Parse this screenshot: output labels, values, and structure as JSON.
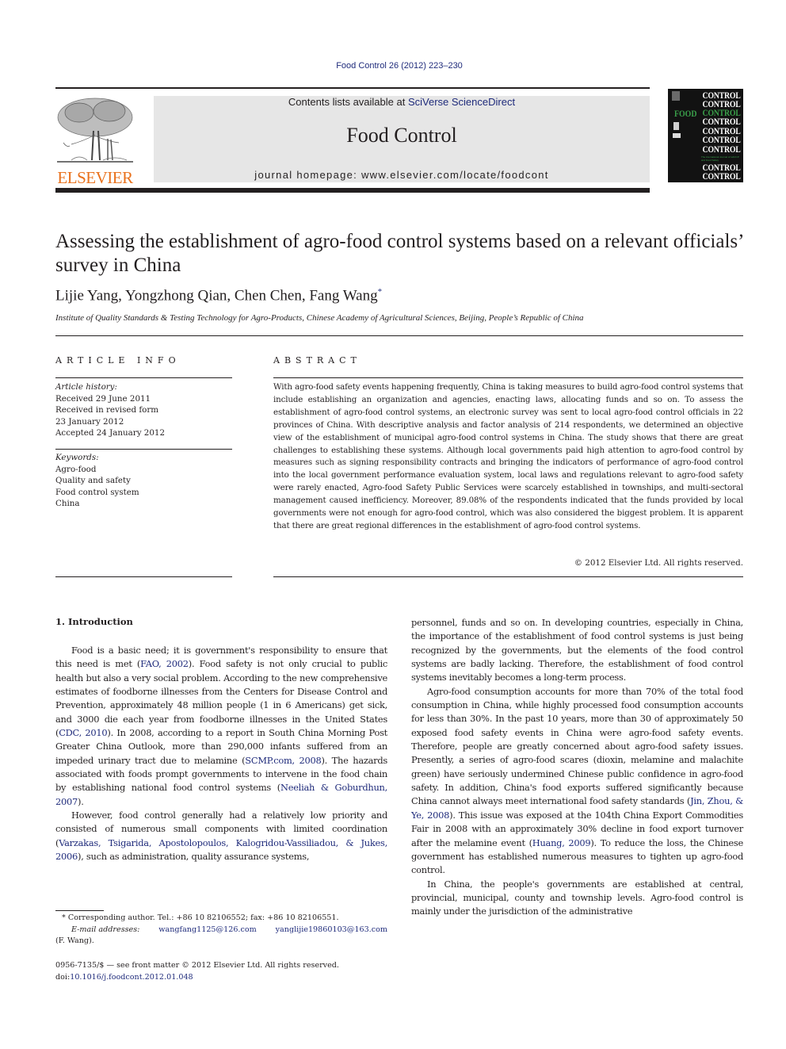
{
  "citation": "Food Control 26 (2012) 223–230",
  "header": {
    "publisher_logo_text": "ELSEVIER",
    "contents_prefix": "Contents lists available at ",
    "contents_link": "SciVerse ScienceDirect",
    "journal_name": "Food Control",
    "homepage": "journal homepage: www.elsevier.com/locate/foodcont",
    "cover": {
      "repeated_word": "CONTROL",
      "food_word": "FOOD",
      "tagline": "The international Journal of HACCP and Food Safety"
    }
  },
  "colors": {
    "link": "#1f2b7b",
    "elsevier_orange": "#e9711c",
    "band_gray": "#e6e6e6",
    "cover_green": "#3aa04a"
  },
  "article": {
    "title": "Assessing the establishment of agro-food control systems based on a relevant officials’ survey in China",
    "authors": "Lijie Yang, Yongzhong Qian, Chen Chen, Fang Wang",
    "author_mark": "*",
    "affiliation": "Institute of Quality Standards & Testing Technology for Agro-Products, Chinese Academy of Agricultural Sciences, Beijing, People’s Republic of China"
  },
  "article_info": {
    "heading": "ARTICLE INFO",
    "history_label": "Article history:",
    "history": [
      "Received 29 June 2011",
      "Received in revised form",
      "23 January 2012",
      "Accepted 24 January 2012"
    ],
    "keywords_label": "Keywords:",
    "keywords": [
      "Agro-food",
      "Quality and safety",
      "Food control system",
      "China"
    ]
  },
  "abstract": {
    "heading": "ABSTRACT",
    "text": "With agro-food safety events happening frequently, China is taking measures to build agro-food control systems that include establishing an organization and agencies, enacting laws, allocating funds and so on. To assess the establishment of agro-food control systems, an electronic survey was sent to local agro-food control officials in 22 provinces of China. With descriptive analysis and factor analysis of 214 respondents, we determined an objective view of the establishment of municipal agro-food control systems in China. The study shows that there are great challenges to establishing these systems. Although local governments paid high attention to agro-food control by measures such as signing responsibility contracts and bringing the indicators of performance of agro-food control into the local government performance evaluation system, local laws and regulations relevant to agro-food safety were rarely enacted, Agro-food Safety Public Services were scarcely established in townships, and multi-sectoral management caused inefficiency. Moreover, 89.08% of the respondents indicated that the funds provided by local governments were not enough for agro-food control, which was also considered the biggest problem. It is apparent that there are great regional differences in the establishment of agro-food control systems.",
    "copyright": "© 2012 Elsevier Ltd. All rights reserved."
  },
  "body": {
    "section_heading": "1.  Introduction",
    "left": {
      "p1": [
        {
          "t": "Food is a basic need; it is government's responsibility to ensure that this need is met ("
        },
        {
          "l": "FAO, 2002"
        },
        {
          "t": "). Food safety is not only crucial to public health but also a very social problem. According to the new comprehensive estimates of foodborne illnesses from the Centers for Disease Control and Prevention, approximately 48 million people (1 in 6 Americans) get sick, and 3000 die each year from foodborne illnesses in the United States ("
        },
        {
          "l": "CDC, 2010"
        },
        {
          "t": "). In 2008, according to a report in South China Morning Post Greater China Outlook, more than 290,000 infants suffered from an impeded urinary tract due to melamine ("
        },
        {
          "l": "SCMP.com, 2008"
        },
        {
          "t": "). The hazards associated with foods prompt governments to intervene in the food chain by establishing national food control systems ("
        },
        {
          "l": "Neeliah & Goburdhun, 2007"
        },
        {
          "t": ")."
        }
      ],
      "p2": [
        {
          "t": "However, food control generally had a relatively low priority and consisted of numerous small components with limited coordination ("
        },
        {
          "l": "Varzakas, Tsigarida, Apostolopoulos, Kalogridou-Vassiliadou, & Jukes, 2006"
        },
        {
          "t": "), such as administration, quality assurance systems,"
        }
      ]
    },
    "right": {
      "p1": [
        {
          "t": "personnel, funds and so on. In developing countries, especially in China, the importance of the establishment of food control systems is just being recognized by the governments, but the elements of the food control systems are badly lacking. Therefore, the establishment of food control systems inevitably becomes a long-term process."
        }
      ],
      "p2": [
        {
          "t": "Agro-food consumption accounts for more than 70% of the total food consumption in China, while highly processed food consumption accounts for less than 30%. In the past 10 years, more than 30 of approximately 50 exposed food safety events in China were agro-food safety events. Therefore, people are greatly concerned about agro-food safety issues. Presently, a series of agro-food scares (dioxin, melamine and malachite green) have seriously undermined Chinese public confidence in agro-food safety. In addition, China's food exports suffered significantly because China cannot always meet international food safety standards ("
        },
        {
          "l": "Jin, Zhou, & Ye, 2008"
        },
        {
          "t": "). This issue was exposed at the 104th China Export Commodities Fair in 2008 with an approximately 30% decline in food export turnover after the melamine event ("
        },
        {
          "l": "Huang, 2009"
        },
        {
          "t": "). To reduce the loss, the Chinese government has established numerous measures to tighten up agro-food control."
        }
      ],
      "p3": [
        {
          "t": "In China, the people's governments are established at central, provincial, municipal, county and township levels. Agro-food control is mainly under the jurisdiction of the administrative"
        }
      ]
    }
  },
  "footnote": {
    "mark": "*",
    "line1": "Corresponding author. Tel.: +86 10 82106552; fax: +86 10 82106551.",
    "email_label": "E-mail addresses:",
    "email1": "wangfang1125@126.com",
    "email2": "yanglijie19860103@163.com",
    "line3": "(F. Wang)."
  },
  "front_matter": {
    "issn_line": "0956-7135/$ — see front matter © 2012 Elsevier Ltd. All rights reserved.",
    "doi_prefix": "doi:",
    "doi": "10.1016/j.foodcont.2012.01.048"
  }
}
